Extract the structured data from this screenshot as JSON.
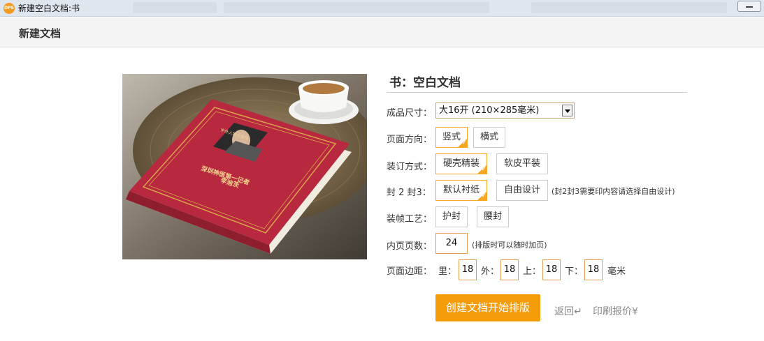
{
  "window": {
    "title": "新建空白文档:书",
    "app_icon_label": "DPS"
  },
  "dialog": {
    "title": "新建文档"
  },
  "form": {
    "heading": "书：空白文档",
    "size_label": "成品尺寸：",
    "size_value": "大16开 (210×285毫米)",
    "orientation_label": "页面方向：",
    "orientation_options": [
      "竖式",
      "横式"
    ],
    "orientation_selected": "竖式",
    "binding_label": "装订方式：",
    "binding_options": [
      "硬壳精装",
      "软皮平装"
    ],
    "binding_selected": "硬壳精装",
    "cover23_label": "封 2 封3：",
    "cover23_options": [
      "默认衬纸",
      "自由设计"
    ],
    "cover23_selected": "默认衬纸",
    "cover23_hint": "(封2封3需要印内容请选择自由设计)",
    "craft_label": "装帧工艺：",
    "craft_options": [
      "护封",
      "腰封"
    ],
    "pages_label": "内页页数：",
    "pages_value": "24",
    "pages_hint": "(排版时可以随时加页)",
    "margin_label": "页面边距：",
    "margin_inner_label": "里：",
    "margin_inner": "18",
    "margin_outer_label": "外：",
    "margin_outer": "18",
    "margin_top_label": "上：",
    "margin_top": "18",
    "margin_bottom_label": "下：",
    "margin_bottom": "18",
    "margin_unit": "毫米"
  },
  "actions": {
    "create": "创建文档开始排版",
    "back": "返回↵",
    "print_quote": "印刷报价¥"
  },
  "cover_image": {
    "top_text": "中外人物大全传",
    "title_line1": "深圳神医第一记者",
    "title_line2": "李迪茨"
  },
  "colors": {
    "accent": "#f59c0b",
    "book_red": "#b8283e"
  }
}
